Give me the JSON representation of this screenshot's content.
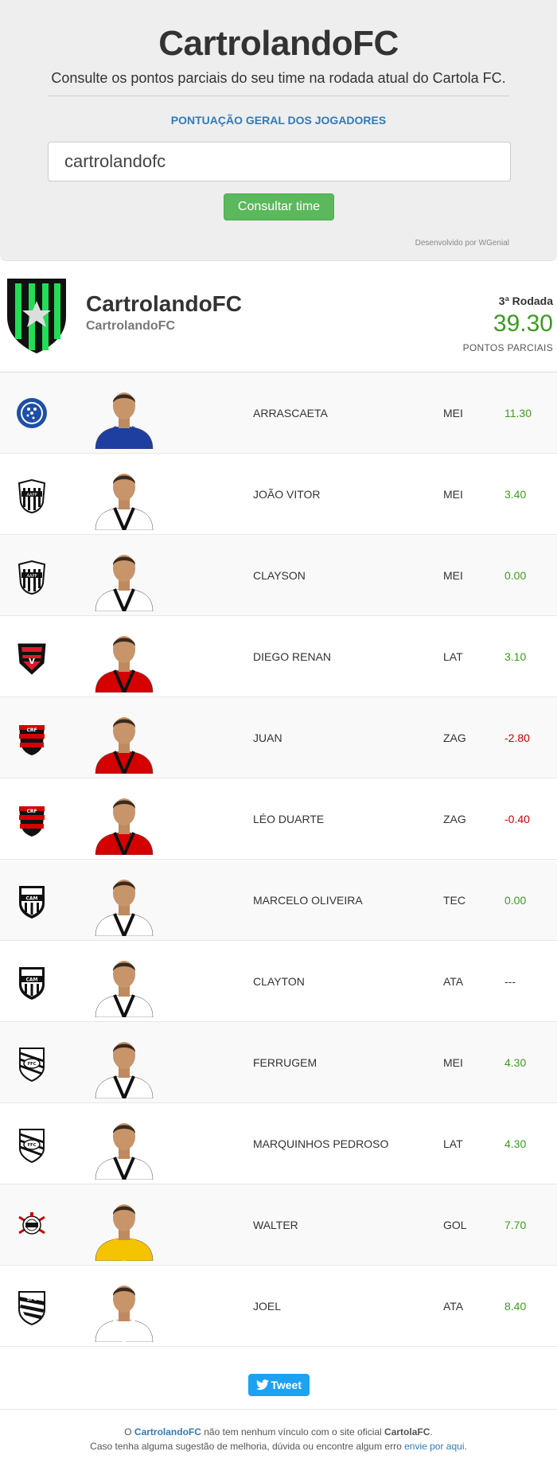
{
  "header": {
    "title": "CartrolandoFC",
    "subtitle": "Consulte os pontos parciais do seu time na rodada atual do Cartola FC.",
    "geral_link": "PONTUAÇÃO GERAL DOS JOGADORES",
    "search_value": "cartrolandofc",
    "button_label": "Consultar time",
    "developed_by": "Desenvolvido por WGenial"
  },
  "team": {
    "name": "CartrolandoFC",
    "user": "CartrolandoFC",
    "round": "3ª Rodada",
    "points": "39.30",
    "points_label": "PONTOS PARCIAIS",
    "colors": {
      "primary": "#111111",
      "secondary": "#22cc55"
    }
  },
  "players": [
    {
      "name": "ARRASCAETA",
      "pos": "MEI",
      "score": "11.30",
      "club": "Cruzeiro"
    },
    {
      "name": "JOÃO VITOR",
      "pos": "MEI",
      "score": "3.40",
      "club": "Ponte Preta"
    },
    {
      "name": "CLAYSON",
      "pos": "MEI",
      "score": "0.00",
      "club": "Ponte Preta"
    },
    {
      "name": "DIEGO RENAN",
      "pos": "LAT",
      "score": "3.10",
      "club": "Vitória"
    },
    {
      "name": "JUAN",
      "pos": "ZAG",
      "score": "-2.80",
      "club": "Flamengo"
    },
    {
      "name": "LÉO DUARTE",
      "pos": "ZAG",
      "score": "-0.40",
      "club": "Flamengo"
    },
    {
      "name": "MARCELO OLIVEIRA",
      "pos": "TEC",
      "score": "0.00",
      "club": "Atlético-MG"
    },
    {
      "name": "CLAYTON",
      "pos": "ATA",
      "score": "---",
      "club": "Atlético-MG"
    },
    {
      "name": "FERRUGEM",
      "pos": "MEI",
      "score": "4.30",
      "club": "Figueirense"
    },
    {
      "name": "MARQUINHOS PEDROSO",
      "pos": "LAT",
      "score": "4.30",
      "club": "Figueirense"
    },
    {
      "name": "WALTER",
      "pos": "GOL",
      "score": "7.70",
      "club": "Corinthians"
    },
    {
      "name": "JOEL",
      "pos": "ATA",
      "score": "8.40",
      "club": "Santos"
    }
  ],
  "footer": {
    "tweet": "Tweet",
    "line1_pre": "O ",
    "line1_site": "CartrolandoFC",
    "line1_mid": " não tem nenhum vínculo com o site oficial ",
    "line1_official": "CartolaFC",
    "line1_end": ".",
    "line2_pre": "Caso tenha alguma sugestão de melhoria, dúvida ou encontre algum erro ",
    "line2_link": "envie por aqui",
    "line2_end": "."
  },
  "icons": {
    "team_shield": "shield-icon",
    "tweet": "twitter-bird-icon"
  }
}
